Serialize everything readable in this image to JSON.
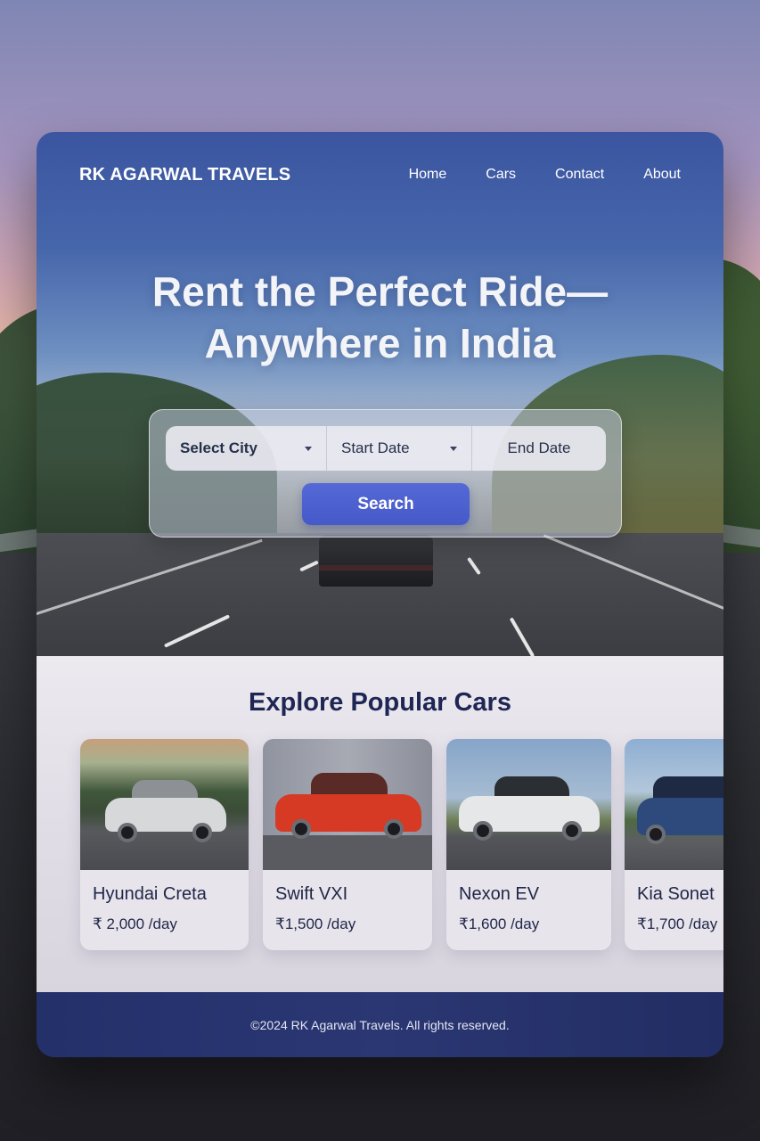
{
  "brand": "RK AGARWAL TRAVELS",
  "nav": {
    "items": [
      {
        "label": "Home"
      },
      {
        "label": "Cars"
      },
      {
        "label": "Contact"
      },
      {
        "label": "About"
      }
    ]
  },
  "hero": {
    "headline_line1": "Rent the Perfect Ride—",
    "headline_line2": "Anywhere in India"
  },
  "search": {
    "city": "Select City",
    "start_date": "Start Date",
    "end_date": "End Date",
    "button": "Search"
  },
  "popular": {
    "title": "Explore Popular Cars",
    "cars": [
      {
        "name": "Hyundai Creta",
        "price": "₹ 2,000 /day",
        "color": "#d7d8d9"
      },
      {
        "name": "Swift VXI",
        "price": "₹1,500 /day",
        "color": "#d63a24"
      },
      {
        "name": "Nexon EV",
        "price": "₹1,600 /day",
        "color": "#e6e7e8"
      },
      {
        "name": "Kia Sonet",
        "price": "₹1,700 /day",
        "color": "#2e4a7c"
      }
    ]
  },
  "footer": {
    "text": "©2024 RK Agarwal Travels. All rights reserved."
  },
  "colors": {
    "accent": "#4f63d2",
    "heading": "#1e2654",
    "footer_bg": "#27336c"
  }
}
